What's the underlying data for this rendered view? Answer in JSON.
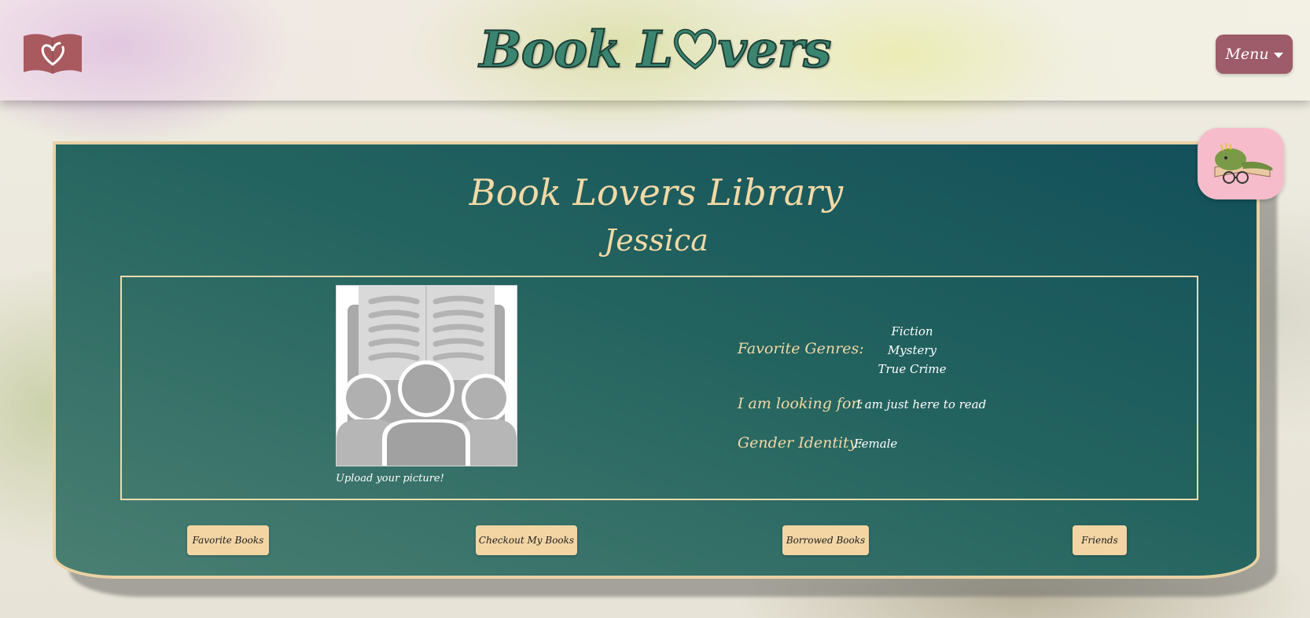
{
  "header": {
    "logo_icon": "heart-book-icon",
    "title_prefix": "Book L",
    "title_suffix": "vers",
    "title_heart_icon": "heart-outline-icon",
    "menu_label": "Menu",
    "menu_icon": "caret-down-icon"
  },
  "profile": {
    "library_title": "Book Lovers Library",
    "user_name": "Jessica",
    "avatar_icon": "book-club-placeholder-icon",
    "upload_label": "Upload your picture!",
    "genres_label": "Favorite Genres:",
    "genres": [
      "Fiction",
      "Mystery",
      "True Crime"
    ],
    "looking_for_label": "I am looking for:",
    "looking_for_value": "I am just here to read",
    "gender_label": "Gender Identity:",
    "gender_value": "Female"
  },
  "actions": {
    "favorite_books": "Favorite Books",
    "checkout_books": "Checkout My Books",
    "borrowed_books": "Borrowed Books",
    "friends": "Friends"
  },
  "mascot_icon": "sleeping-dinosaur-book-icon",
  "colors": {
    "brand_green": "#3a8470",
    "card_teal": "#124f5a",
    "cream": "#f2d9a6",
    "menu_mauve": "#9e5b6a",
    "logo_red": "#a85a5f",
    "mascot_pink": "#f7bccb"
  }
}
